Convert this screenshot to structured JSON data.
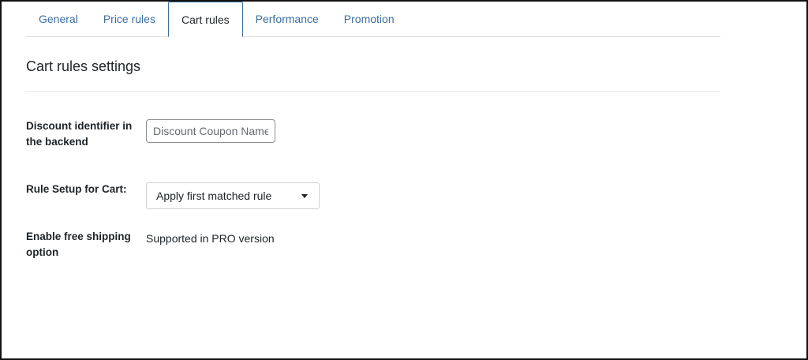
{
  "tabs": [
    {
      "label": "General"
    },
    {
      "label": "Price rules"
    },
    {
      "label": "Cart rules",
      "active": true
    },
    {
      "label": "Performance"
    },
    {
      "label": "Promotion"
    }
  ],
  "section": {
    "title": "Cart rules settings"
  },
  "fields": {
    "discount_identifier": {
      "label": "Discount identifier in the backend",
      "value": "",
      "placeholder": "Discount Coupon Name"
    },
    "rule_setup": {
      "label": "Rule Setup for Cart:",
      "selected": "Apply first matched rule"
    },
    "free_shipping": {
      "label": "Enable free shipping option",
      "value": "Supported in PRO version"
    }
  },
  "colors": {
    "tab_link": "#3a6e9f",
    "text": "#1d2327",
    "border": "#dcdcde"
  }
}
